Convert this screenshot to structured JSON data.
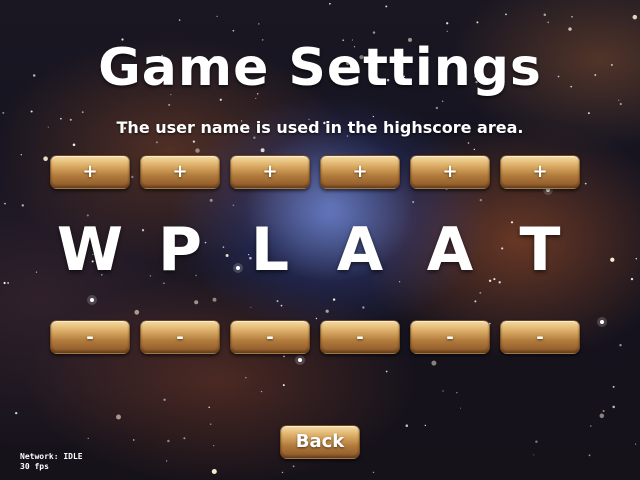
{
  "screen": {
    "title": "Game Settings",
    "subtitle": "The user name is used in the highscore area."
  },
  "name_editor": {
    "increment_label": "+",
    "decrement_label": "-",
    "letters": [
      "W",
      "P",
      "L",
      "A",
      "A",
      "T"
    ]
  },
  "back_button": {
    "label": "Back"
  },
  "status": {
    "network": "Network: IDLE",
    "fps": "30 fps"
  },
  "colors": {
    "button_top": "#f6dca4",
    "button_bottom": "#8a5628",
    "text": "#ffffff"
  }
}
